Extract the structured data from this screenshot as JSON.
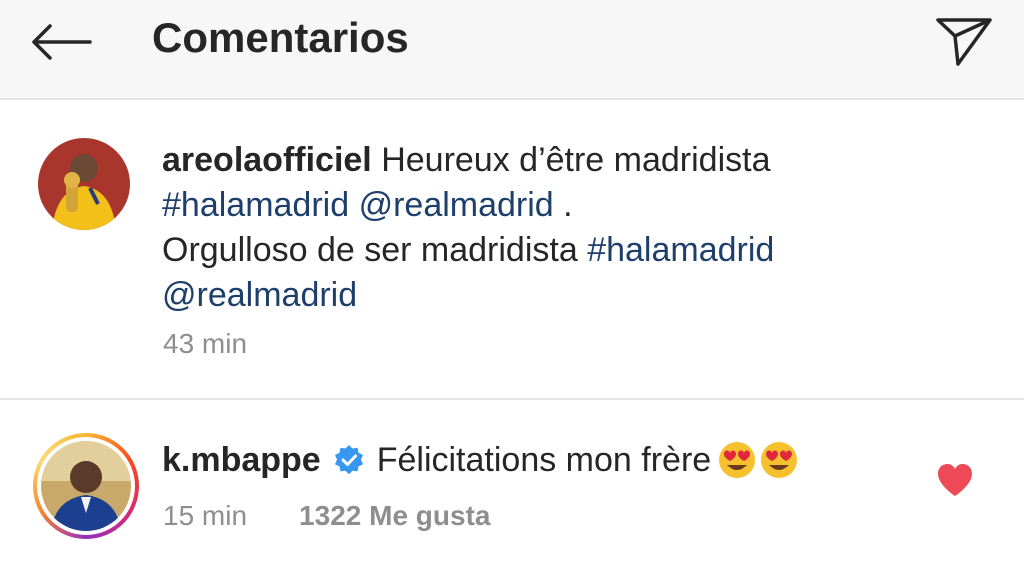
{
  "header": {
    "title": "Comentarios",
    "back_icon": "arrow-left-icon",
    "send_icon": "paper-plane-icon"
  },
  "post": {
    "username": "areolaofficiel",
    "text_part1": " Heureux d’être madridista",
    "hashtag1": "#halamadrid",
    "mention1": "@realmadrid",
    "text_part2": " .",
    "text_part3": "Orgulloso de ser madridista ",
    "hashtag2": "#halamadrid",
    "mention2": "@realmadrid",
    "time": "43 min"
  },
  "comment": {
    "username": "k.mbappe",
    "text": "Félicitations mon frère",
    "time": "15 min",
    "likes": "1322 Me gusta",
    "liked": true
  },
  "colors": {
    "hashtag": "#1e3f6b",
    "verified": "#3897f0",
    "heart": "#ed4956",
    "meta": "#8e8e8e"
  }
}
